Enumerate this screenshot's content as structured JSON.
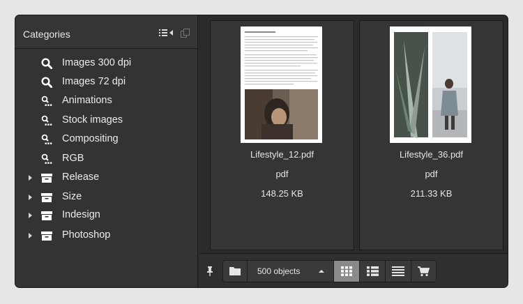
{
  "sidebar": {
    "title": "Categories",
    "items": [
      {
        "label": "Images 300 dpi",
        "icon": "search-icon",
        "expandable": false
      },
      {
        "label": "Images 72 dpi",
        "icon": "search-icon",
        "expandable": false
      },
      {
        "label": "Animations",
        "icon": "search-dots-icon",
        "expandable": false
      },
      {
        "label": "Stock images",
        "icon": "search-dots-icon",
        "expandable": false
      },
      {
        "label": "Compositing",
        "icon": "search-dots-icon",
        "expandable": false
      },
      {
        "label": "RGB",
        "icon": "search-dots-icon",
        "expandable": false
      },
      {
        "label": "Release",
        "icon": "archive-box-icon",
        "expandable": true
      },
      {
        "label": "Size",
        "icon": "archive-box-icon",
        "expandable": true
      },
      {
        "label": "Indesign",
        "icon": "archive-box-icon",
        "expandable": true
      },
      {
        "label": "Photoshop",
        "icon": "archive-box-icon",
        "expandable": true
      }
    ]
  },
  "files": [
    {
      "name": "Lifestyle_12.pdf",
      "type": "pdf",
      "size": "148.25 KB"
    },
    {
      "name": "Lifestyle_36.pdf",
      "type": "pdf",
      "size": "211.33 KB"
    }
  ],
  "toolbar": {
    "object_count": "500 objects",
    "active_view": "grid"
  },
  "colors": {
    "panel": "#333333",
    "background": "#2b2b2b",
    "text": "#e8e8e8",
    "active_button": "#8a8a8a"
  }
}
